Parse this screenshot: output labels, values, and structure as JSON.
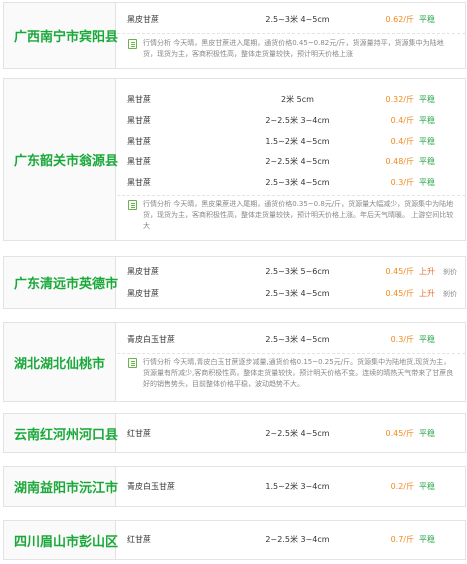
{
  "cards": [
    {
      "region": "广西南宁市宾阳县",
      "rows": [
        {
          "name": "黑皮甘蔗",
          "spec": "2.5~3米 4~5cm",
          "price": "0.62/斤",
          "trend": "平稳",
          "extra": ""
        }
      ],
      "analysis": "行情分析 今天晴，黑皮甘蔗进入尾期，通货价格0.45~0.82元/斤，货源量持平，货源集中为陆地货，现货为主，客商积极性高，整体走货量较快，预计明天价格上涨"
    },
    {
      "region": "广东韶关市翁源县",
      "rows": [
        {
          "name": "黑甘蔗",
          "spec": "2米 5cm",
          "price": "0.32/斤",
          "trend": "平稳",
          "extra": ""
        },
        {
          "name": "黑甘蔗",
          "spec": "2~2.5米 3~4cm",
          "price": "0.4/斤",
          "trend": "平稳",
          "extra": ""
        },
        {
          "name": "黑甘蔗",
          "spec": "1.5~2米 4~5cm",
          "price": "0.4/斤",
          "trend": "平稳",
          "extra": ""
        },
        {
          "name": "黑甘蔗",
          "spec": "2~2.5米 4~5cm",
          "price": "0.48/斤",
          "trend": "平稳",
          "extra": ""
        },
        {
          "name": "黑甘蔗",
          "spec": "2.5~3米 4~5cm",
          "price": "0.3/斤",
          "trend": "平稳",
          "extra": ""
        }
      ],
      "analysis": "行情分析 今天晴，黑皮果蔗进入尾期，通货价格0.35~0.8元/斤，货源量大幅减少，货源集中为陆地货，现货为主，客商积极性高，整体走货量较快，预计明天价格上涨。年后天气晴暖。 上游空间比较大"
    },
    {
      "region": "广东清远市英德市",
      "rows": [
        {
          "name": "黑皮甘蔗",
          "spec": "2.5~3米 5~6cm",
          "price": "0.45/斤",
          "trend": "上升",
          "extra": "刹价"
        },
        {
          "name": "黑皮甘蔗",
          "spec": "2.5~3米 4~5cm",
          "price": "0.45/斤",
          "trend": "上升",
          "extra": "刹价"
        }
      ],
      "analysis": ""
    },
    {
      "region": "湖北湖北仙桃市",
      "rows": [
        {
          "name": "青皮白玉甘蔗",
          "spec": "2.5~3米 4~5cm",
          "price": "0.3/斤",
          "trend": "平稳",
          "extra": ""
        }
      ],
      "analysis": "行情分析 今天晴,青皮白玉甘蔗逐步减量,通货价格0.15~0.25元/斤。货源集中为陆地货,现货为主，货源量有所减少,客商积极性高，整体走货量较快，预计明天价格不变。连续的晴热天气带来了甘蔗良好的销售势头，目前整体价格平稳，波动趋势不大。"
    },
    {
      "region": "云南红河州河口县",
      "rows": [
        {
          "name": "红甘蔗",
          "spec": "2~2.5米 4~5cm",
          "price": "0.45/斤",
          "trend": "平稳",
          "extra": ""
        }
      ],
      "analysis": ""
    },
    {
      "region": "湖南益阳市沅江市",
      "rows": [
        {
          "name": "青皮白玉甘蔗",
          "spec": "1.5~2米 3~4cm",
          "price": "0.2/斤",
          "trend": "平稳",
          "extra": ""
        }
      ],
      "analysis": ""
    },
    {
      "region": "四川眉山市彭山区",
      "rows": [
        {
          "name": "红甘蔗",
          "spec": "2~2.5米 3~4cm",
          "price": "0.7/斤",
          "trend": "平稳",
          "extra": ""
        }
      ],
      "analysis": ""
    }
  ]
}
